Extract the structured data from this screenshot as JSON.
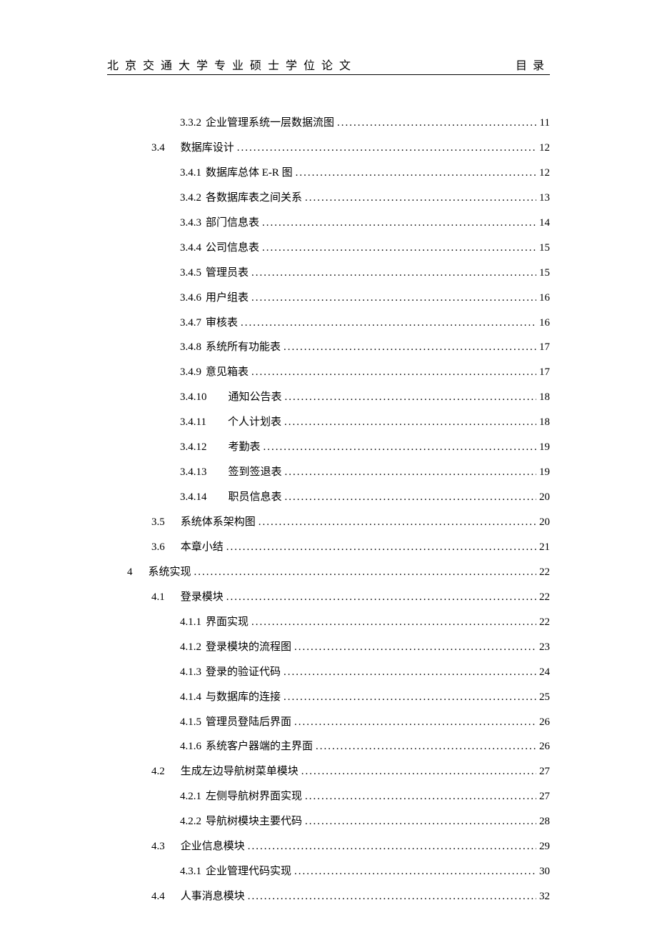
{
  "header": {
    "left": "北京交通大学专业硕士学位论文",
    "right": "目录"
  },
  "toc": [
    {
      "lvl": "l3",
      "num": "3.3.2",
      "title": "企业管理系统一层数据流图",
      "page": "11"
    },
    {
      "lvl": "l2",
      "num": "3.4",
      "title": "数据库设计",
      "page": "12",
      "sp": true
    },
    {
      "lvl": "l3",
      "num": "3.4.1",
      "title": "数据库总体 E-R 图",
      "page": "12"
    },
    {
      "lvl": "l3",
      "num": "3.4.2",
      "title": "各数据库表之间关系",
      "page": "13"
    },
    {
      "lvl": "l3",
      "num": "3.4.3",
      "title": "部门信息表",
      "page": "14"
    },
    {
      "lvl": "l3",
      "num": "3.4.4",
      "title": "公司信息表",
      "page": "15"
    },
    {
      "lvl": "l3",
      "num": "3.4.5",
      "title": "管理员表",
      "page": "15"
    },
    {
      "lvl": "l3",
      "num": "3.4.6",
      "title": "用户组表",
      "page": "16"
    },
    {
      "lvl": "l3",
      "num": "3.4.7",
      "title": "审核表",
      "page": "16"
    },
    {
      "lvl": "l3",
      "num": "3.4.8",
      "title": "系统所有功能表",
      "page": "17"
    },
    {
      "lvl": "l3",
      "num": "3.4.9",
      "title": "意见箱表",
      "page": "17"
    },
    {
      "lvl": "l3b",
      "num": "3.4.10",
      "title": "通知公告表",
      "page": "18",
      "sp2": true
    },
    {
      "lvl": "l3b",
      "num": "3.4.11",
      "title": "个人计划表",
      "page": "18",
      "sp2": true
    },
    {
      "lvl": "l3b",
      "num": "3.4.12",
      "title": "考勤表",
      "page": "19",
      "sp2": true
    },
    {
      "lvl": "l3b",
      "num": "3.4.13",
      "title": "签到签退表",
      "page": "19",
      "sp2": true
    },
    {
      "lvl": "l3b",
      "num": "3.4.14",
      "title": "职员信息表",
      "page": "20",
      "sp2": true
    },
    {
      "lvl": "l2",
      "num": "3.5",
      "title": "系统体系架构图",
      "page": "20",
      "sp": true
    },
    {
      "lvl": "l2",
      "num": "3.6",
      "title": "本章小结",
      "page": "21",
      "sp": true
    },
    {
      "lvl": "l1",
      "num": "4",
      "title": "系统实现",
      "page": "22",
      "sp": true
    },
    {
      "lvl": "l2",
      "num": "4.1",
      "title": "登录模块",
      "page": "22",
      "sp": true
    },
    {
      "lvl": "l3",
      "num": "4.1.1",
      "title": "界面实现",
      "page": "22"
    },
    {
      "lvl": "l3",
      "num": "4.1.2",
      "title": "登录模块的流程图",
      "page": "23"
    },
    {
      "lvl": "l3",
      "num": "4.1.3",
      "title": "登录的验证代码",
      "page": "24"
    },
    {
      "lvl": "l3",
      "num": "4.1.4",
      "title": "与数据库的连接",
      "page": "25"
    },
    {
      "lvl": "l3",
      "num": "4.1.5",
      "title": "管理员登陆后界面",
      "page": "26"
    },
    {
      "lvl": "l3",
      "num": "4.1.6",
      "title": "系统客户器端的主界面",
      "page": "26"
    },
    {
      "lvl": "l2",
      "num": "4.2",
      "title": "生成左边导航树菜单模块",
      "page": "27",
      "sp": true
    },
    {
      "lvl": "l3",
      "num": "4.2.1",
      "title": "左侧导航树界面实现",
      "page": "27"
    },
    {
      "lvl": "l3",
      "num": "4.2.2",
      "title": "导航树模块主要代码",
      "page": "28"
    },
    {
      "lvl": "l2",
      "num": "4.3",
      "title": "企业信息模块",
      "page": "29",
      "sp": true
    },
    {
      "lvl": "l3",
      "num": "4.3.1",
      "title": "企业管理代码实现",
      "page": "30"
    },
    {
      "lvl": "l2",
      "num": "4.4",
      "title": "人事消息模块",
      "page": "32",
      "sp": true
    }
  ]
}
